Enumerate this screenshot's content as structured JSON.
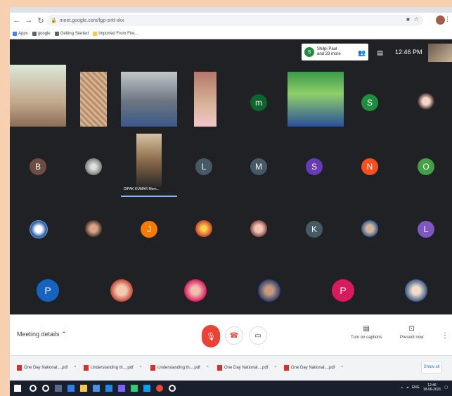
{
  "browser": {
    "url": "meet.google.com/fgp-sntt-xkx",
    "bookmarks": [
      {
        "label": "Apps",
        "icon": "apps-icon"
      },
      {
        "label": "google",
        "icon": "google-icon"
      },
      {
        "label": "Getting Started",
        "icon": "firefox-icon"
      },
      {
        "label": "Imported From Fire...",
        "icon": "folder-icon"
      }
    ]
  },
  "meet_top": {
    "participant_initial": "S",
    "participant_line1": "Shilpi Paul",
    "participant_line2": "and 33 more",
    "clock": "12:46 PM"
  },
  "grid": {
    "speaker_name": "DIPAK KUMAR Mem...",
    "avatars": [
      {
        "letter": "m",
        "color": "#0d652d"
      },
      {
        "letter": "S",
        "color": "#1e8e3e"
      },
      {
        "letter": "B",
        "color": "#6d4c41"
      },
      {
        "letter": "L",
        "color": "#455a64"
      },
      {
        "letter": "M",
        "color": "#455a64"
      },
      {
        "letter": "S",
        "color": "#673ab7"
      },
      {
        "letter": "N",
        "color": "#f4511e"
      },
      {
        "letter": "O",
        "color": "#43a047"
      },
      {
        "letter": "J",
        "color": "#f57c00"
      },
      {
        "letter": "K",
        "color": "#455a64"
      },
      {
        "letter": "L",
        "color": "#7e57c2"
      },
      {
        "letter": "P",
        "color": "#1565c0"
      },
      {
        "letter": "P",
        "color": "#d81b60"
      }
    ]
  },
  "meet_bottom": {
    "meeting_details": "Meeting details",
    "captions_label": "Turn on captions",
    "present_label": "Present now"
  },
  "downloads": {
    "files": [
      "One Day National....pdf",
      "Understanding th....pdf",
      "Understanding th....pdf",
      "One Day National....pdf",
      "One Day National....pdf"
    ],
    "show_all": "Show all"
  },
  "taskbar": {
    "lang": "ENG",
    "time": "12:46",
    "date": "18-06-2021"
  },
  "colors": {
    "meet_bg": "#202124",
    "leave_red": "#ea4335",
    "speaker_highlight": "#8ab4f8"
  }
}
